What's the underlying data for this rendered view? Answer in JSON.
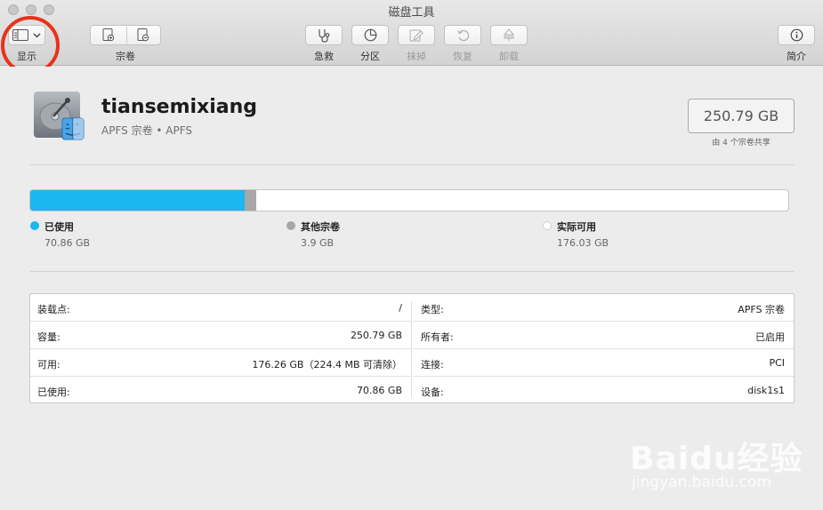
{
  "window": {
    "title": "磁盘工具"
  },
  "toolbar": {
    "view_label": "显示",
    "volume_label": "宗卷",
    "firstaid_label": "急救",
    "partition_label": "分区",
    "erase_label": "抹掉",
    "restore_label": "恢复",
    "unmount_label": "卸载",
    "info_label": "简介"
  },
  "volume": {
    "name": "tiansemixiang",
    "subtitle": "APFS 宗卷 • APFS",
    "capacity": "250.79 GB",
    "capacity_note": "由 4 个宗卷共享"
  },
  "usage": {
    "used_fraction": 0.2825,
    "other_fraction": 0.0156,
    "colors": {
      "used": "#1ab7f0",
      "other": "#a7a7a7",
      "free": "#ffffff"
    },
    "legend": [
      {
        "name": "已使用",
        "value": "70.86 GB"
      },
      {
        "name": "其他宗卷",
        "value": "3.9 GB"
      },
      {
        "name": "实际可用",
        "value": "176.03 GB"
      }
    ]
  },
  "info": {
    "left": [
      {
        "key": "装载点:",
        "value": "/"
      },
      {
        "key": "容量:",
        "value": "250.79 GB"
      },
      {
        "key": "可用:",
        "value": "176.26 GB（224.4 MB 可清除）"
      },
      {
        "key": "已使用:",
        "value": "70.86 GB"
      }
    ],
    "right": [
      {
        "key": "类型:",
        "value": "APFS 宗卷"
      },
      {
        "key": "所有者:",
        "value": "已启用"
      },
      {
        "key": "连接:",
        "value": "PCI"
      },
      {
        "key": "设备:",
        "value": "disk1s1"
      }
    ]
  },
  "watermark": {
    "logo": "Baidu经验",
    "url": "jingyan.baidu.com"
  }
}
